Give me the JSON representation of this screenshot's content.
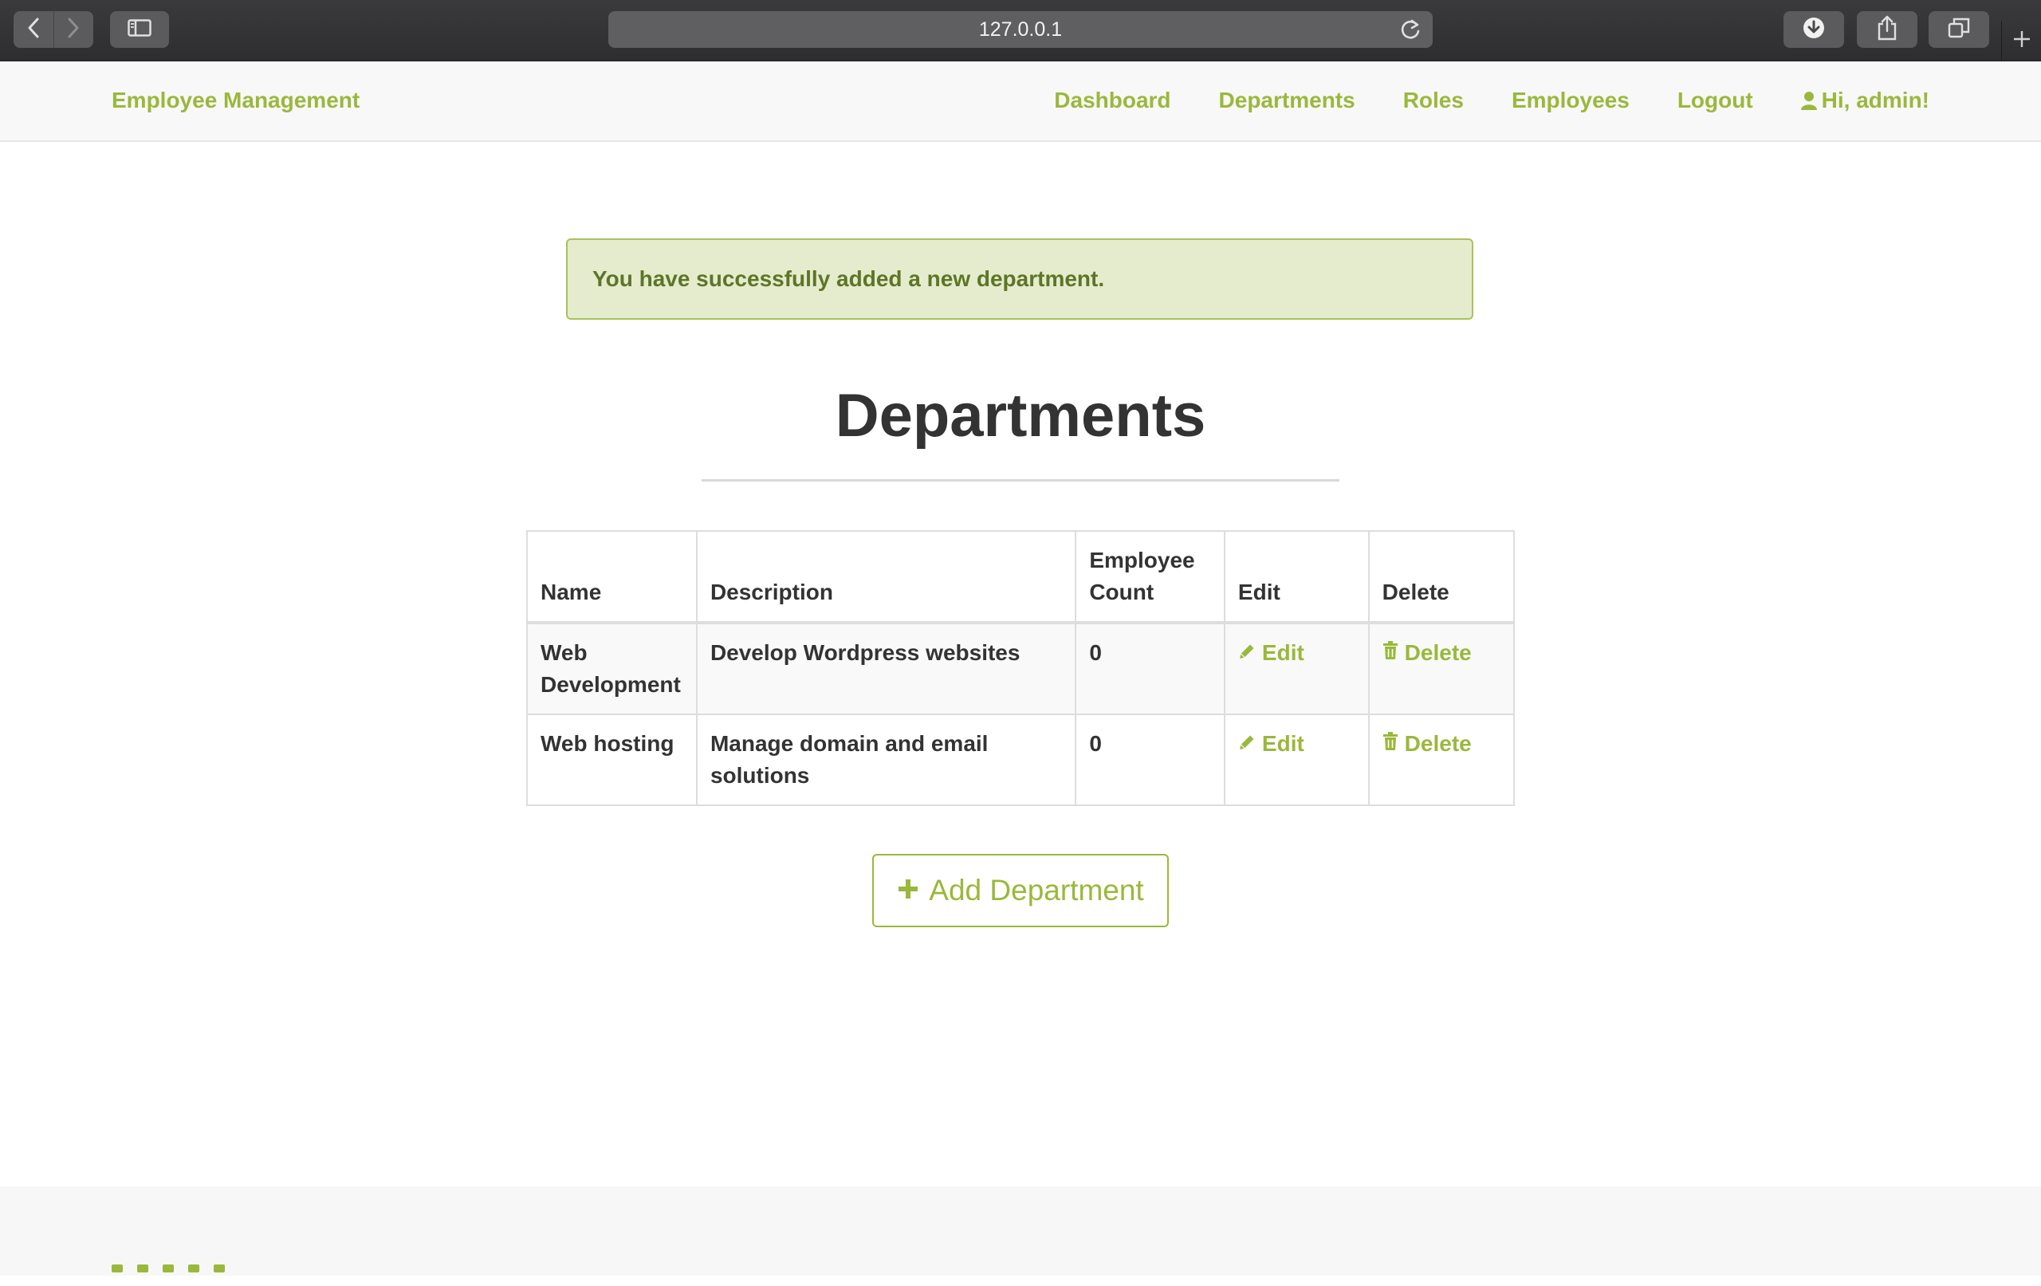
{
  "browser": {
    "url": "127.0.0.1",
    "icons": [
      "back-icon",
      "forward-icon",
      "sidebar-icon",
      "reload-icon",
      "download-icon",
      "share-icon",
      "tabs-icon",
      "new-tab-icon"
    ]
  },
  "navbar": {
    "brand": "Employee Management",
    "links": [
      "Dashboard",
      "Departments",
      "Roles",
      "Employees",
      "Logout"
    ],
    "user_greeting": "Hi, admin!",
    "accent_color": "#9ab83b"
  },
  "alert": {
    "message": "You have successfully added a new department."
  },
  "page": {
    "title": "Departments"
  },
  "table": {
    "headers": {
      "name": "Name",
      "description": "Description",
      "count": "Employee Count",
      "edit": "Edit",
      "delete": "Delete"
    },
    "rows": [
      {
        "name": "Web Development",
        "description": "Develop Wordpress websites",
        "count": "0",
        "edit": "Edit",
        "delete": "Delete"
      },
      {
        "name": "Web hosting",
        "description": "Manage domain and email solutions",
        "count": "0",
        "edit": "Edit",
        "delete": "Delete"
      }
    ]
  },
  "actions": {
    "add_department": "Add Department"
  }
}
